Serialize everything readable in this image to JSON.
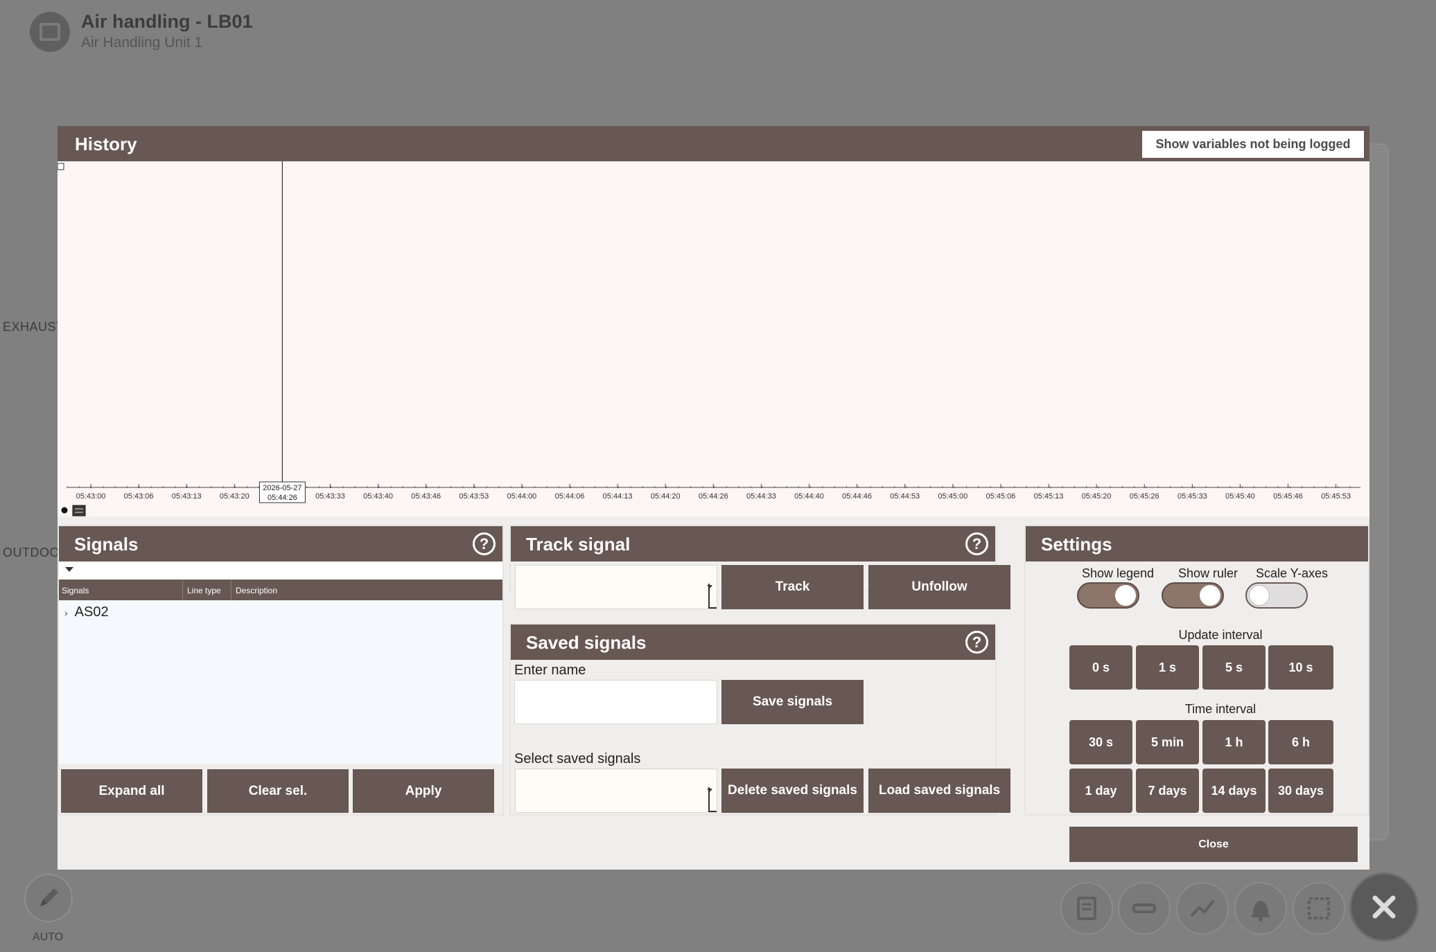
{
  "app": {
    "title": "Air handling - LB01",
    "subtitle": "Air Handling Unit 1",
    "side_labels": [
      "EXHAUST",
      "OUTDOOR"
    ],
    "auto_label": "AUTO",
    "dock_icons": [
      "report-icon",
      "minus-icon",
      "trend-icon",
      "alarm-icon",
      "frame-icon",
      "close-icon"
    ]
  },
  "history": {
    "title": "History",
    "show_vars_label": "Show variables not being logged",
    "time_ticks": [
      "05:43:00",
      "05:43:06",
      "05:43:13",
      "05:43:20",
      "05:43:26",
      "05:43:33",
      "05:43:40",
      "05:43:46",
      "05:43:53",
      "05:44:00",
      "05:44:06",
      "05:44:13",
      "05:44:20",
      "05:44:26",
      "05:44:33",
      "05:44:40",
      "05:44:46",
      "05:44:53",
      "05:45:00",
      "05:45:06",
      "05:45:13",
      "05:45:20",
      "05:45:26",
      "05:45:33",
      "05:45:40",
      "05:45:46",
      "05:45:53"
    ],
    "cursor_tick_index": 4,
    "cursor_date": "2026-05-27",
    "cursor_time": "05:44:26"
  },
  "signals": {
    "title": "Signals",
    "columns": [
      "Signals",
      "Line type",
      "Description"
    ],
    "rows": [
      {
        "name": "AS02"
      }
    ],
    "expand_all": "Expand all",
    "clear_sel": "Clear sel.",
    "apply": "Apply"
  },
  "track": {
    "title": "Track signal",
    "track_label": "Track",
    "unfollow_label": "Unfollow"
  },
  "saved": {
    "title": "Saved signals",
    "enter_name_label": "Enter name",
    "save_label": "Save signals",
    "select_label": "Select saved signals",
    "delete_label": "Delete saved signals",
    "load_label": "Load saved signals"
  },
  "settings": {
    "title": "Settings",
    "toggles": [
      {
        "label": "Show legend",
        "on": true
      },
      {
        "label": "Show ruler",
        "on": true
      },
      {
        "label": "Scale Y-axes",
        "on": false
      }
    ],
    "update_interval_label": "Update interval",
    "update_options": [
      "0 s",
      "1 s",
      "5 s",
      "10 s"
    ],
    "time_interval_label": "Time interval",
    "time_options": [
      "30 s",
      "5 min",
      "1 h",
      "6 h",
      "1 day",
      "7 days",
      "14 days",
      "30 days"
    ],
    "close_label": "Close"
  },
  "colors": {
    "accent": "#675853",
    "plot_bg": "#fcf6f4",
    "overlay": "#808080"
  }
}
